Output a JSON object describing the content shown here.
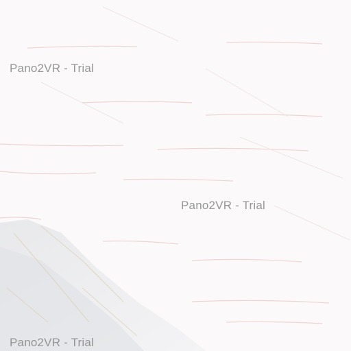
{
  "viewer": {
    "watermarks": [
      {
        "text": "Pano2VR - Trial"
      },
      {
        "text": "Pano2VR - Trial"
      },
      {
        "text": "Pano2VR - Trial"
      }
    ]
  },
  "texture": {
    "base_color": "#fbf9f9",
    "vein_color": "#e8c9c6",
    "shadow_color": "#dfe0e3"
  }
}
